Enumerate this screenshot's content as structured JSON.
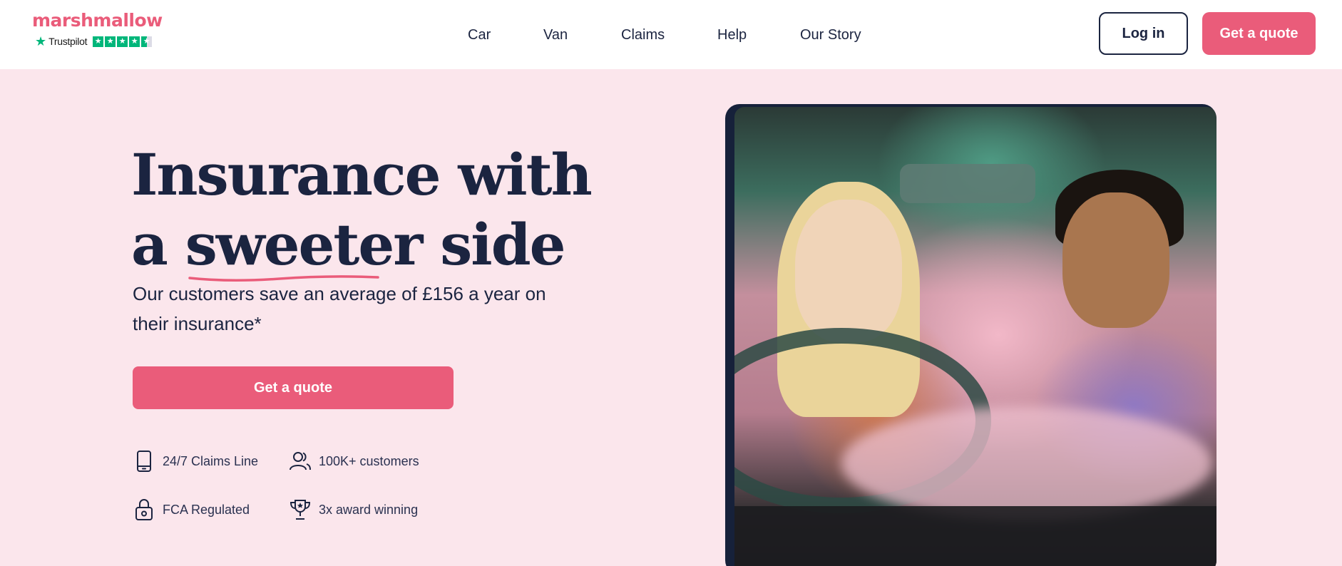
{
  "brand": {
    "name": "marshmallow",
    "trustpilot": "Trustpilot",
    "accent": "#ea5c7a",
    "navy": "#1b2440",
    "background": "#fbe6ec"
  },
  "nav": {
    "items": [
      "Car",
      "Van",
      "Claims",
      "Help",
      "Our Story"
    ]
  },
  "header": {
    "login_label": "Log in",
    "quote_label": "Get a quote"
  },
  "hero": {
    "title_line1": "Insurance with",
    "title_a": "a",
    "title_highlight": "sweeter",
    "title_end": "side",
    "subtitle": "Our customers save an average of £156 a year on their insurance*",
    "cta_label": "Get a quote"
  },
  "features": [
    {
      "icon": "phone-icon",
      "label": "24/7 Claims Line"
    },
    {
      "icon": "users-icon",
      "label": "100K+ customers"
    },
    {
      "icon": "lock-icon",
      "label": "FCA Regulated"
    },
    {
      "icon": "trophy-icon",
      "label": "3x award winning"
    }
  ]
}
